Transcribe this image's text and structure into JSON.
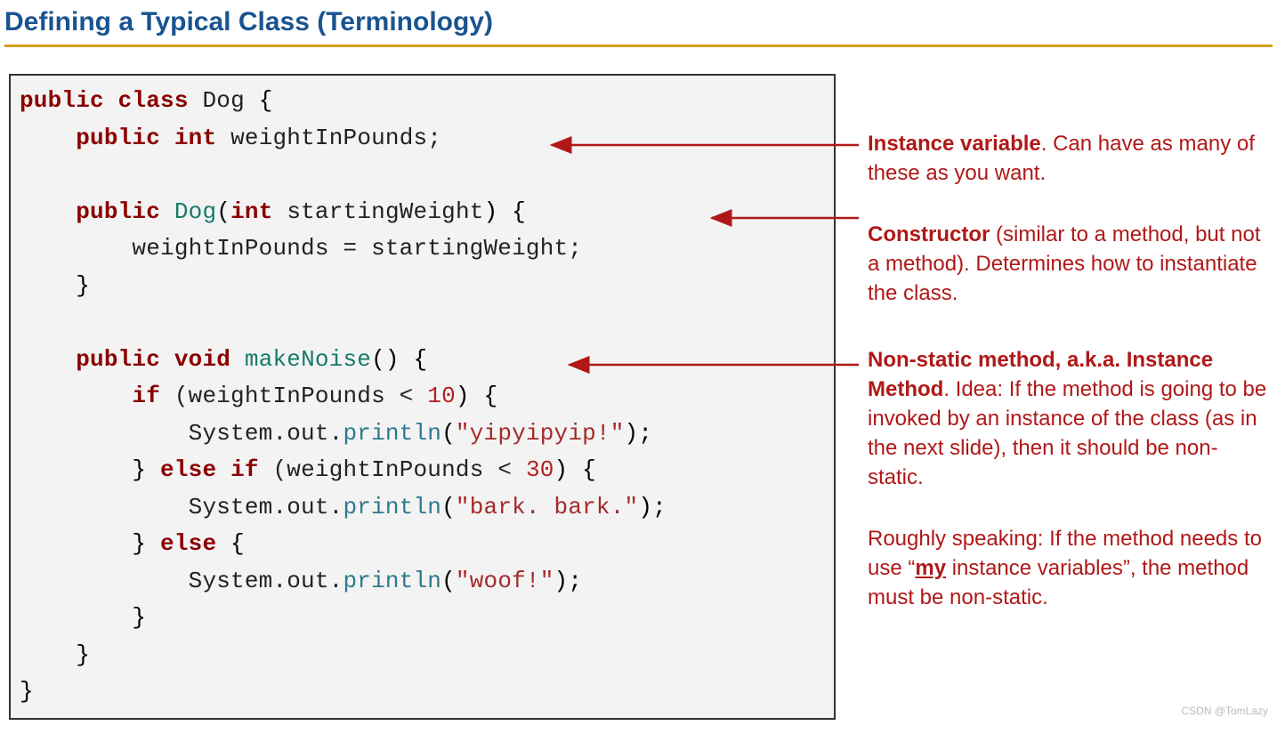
{
  "heading": "Defining a Typical Class (Terminology)",
  "code": {
    "l1_public": "public",
    "l1_class": "class",
    "l1_name": "Dog",
    "l2_public": "public",
    "l2_int": "int",
    "l2_var": "weightInPounds;",
    "l4_public": "public",
    "l4_ctor": "Dog",
    "l4_int": "int",
    "l4_param": "startingWeight",
    "l5_body": "weightInPounds = startingWeight;",
    "l8_public": "public",
    "l8_void": "void",
    "l8_method": "makeNoise",
    "l9_if": "if",
    "l9_cond_a": "(weightInPounds < ",
    "l9_n10": "10",
    "l10_sys": "System.out.",
    "l10_println": "println",
    "l10_str": "\"yipyipyip!\"",
    "l11_else": "else",
    "l11_if": "if",
    "l11_cond_a": "(weightInPounds < ",
    "l11_n30": "30",
    "l12_sys": "System.out.",
    "l12_println": "println",
    "l12_str": "\"bark. bark.\"",
    "l13_else": "else",
    "l14_sys": "System.out.",
    "l14_println": "println",
    "l14_str": "\"woof!\""
  },
  "annotations": {
    "a1_bold": "Instance variable",
    "a1_rest": ". Can have as many of these as you want.",
    "a2_bold": "Constructor",
    "a2_rest": " (similar to a method, but not a method). Determines how to instantiate the class.",
    "a3_bold": "Non-static method, a.k.a. Instance Method",
    "a3_rest": ". Idea: If the method is going to be invoked by an instance of the class (as in the next slide), then it should be non-static.",
    "a4_pre": "Roughly speaking: If the method needs to use “",
    "a4_my": "my",
    "a4_post": " instance variables”, the method must be non-static."
  },
  "watermark": "CSDN @TomLazy"
}
